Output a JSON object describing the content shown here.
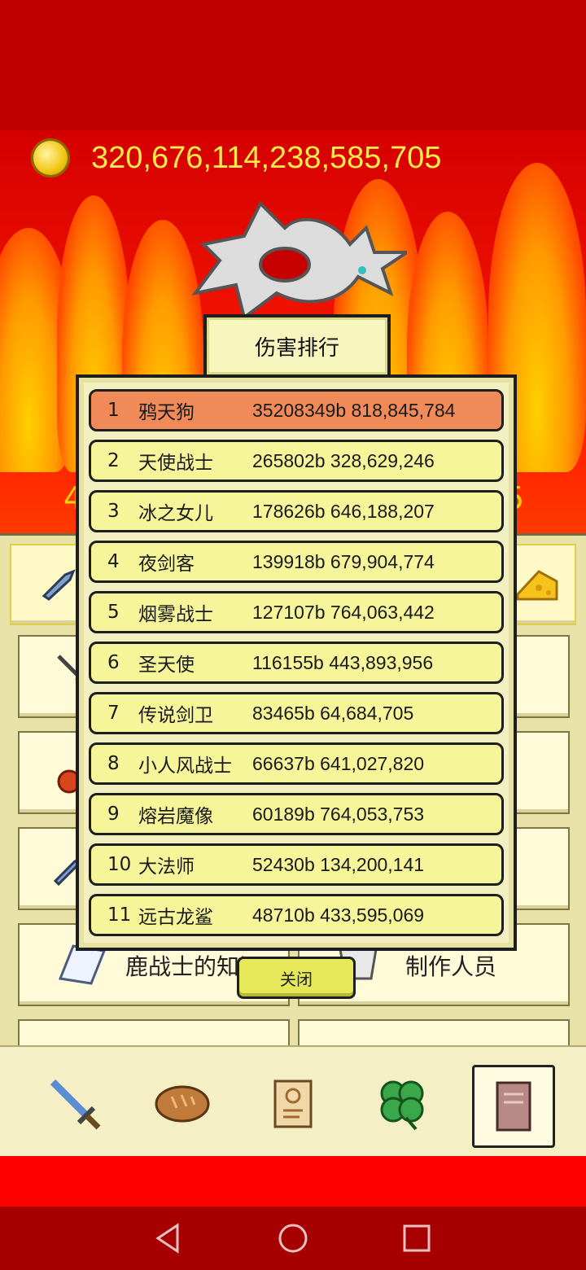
{
  "currency": {
    "amount": "320,676,114,238,585,705",
    "icon": "gold-coin-icon"
  },
  "background_numbers": {
    "left": "4",
    "right": "5"
  },
  "ranking": {
    "title": "伤害排行",
    "rows": [
      {
        "rank": "1",
        "name": "鸦天狗",
        "score": "35208349b 818,845,784"
      },
      {
        "rank": "2",
        "name": "天使战士",
        "score": "265802b 328,629,246"
      },
      {
        "rank": "3",
        "name": "冰之女儿",
        "score": "178626b 646,188,207"
      },
      {
        "rank": "4",
        "name": "夜剑客",
        "score": "139918b 679,904,774"
      },
      {
        "rank": "5",
        "name": "烟雾战士",
        "score": "127107b 764,063,442"
      },
      {
        "rank": "6",
        "name": "圣天使",
        "score": "116155b 443,893,956"
      },
      {
        "rank": "7",
        "name": "传说剑卫",
        "score": "83465b 64,684,705"
      },
      {
        "rank": "8",
        "name": "小人风战士",
        "score": "66637b 641,027,820"
      },
      {
        "rank": "9",
        "name": "熔岩魔像",
        "score": "60189b 764,053,753"
      },
      {
        "rank": "10",
        "name": "大法师",
        "score": "52430b 134,200,141"
      },
      {
        "rank": "11",
        "name": "远古龙鲨",
        "score": "48710b 433,595,069"
      }
    ],
    "close_label": "关闭"
  },
  "menu": {
    "knowledge_label": "鹿战士的知识",
    "credits_label": "制作人员"
  },
  "nav": {
    "items": [
      "sword-icon",
      "bread-icon",
      "scroll-icon",
      "clover-icon",
      "book-icon"
    ],
    "active_index": 4
  },
  "colors": {
    "first_row": "#f08a58",
    "row": "#f6f59a",
    "panel": "#e9e2a8",
    "gold_text": "#ffe94d"
  }
}
